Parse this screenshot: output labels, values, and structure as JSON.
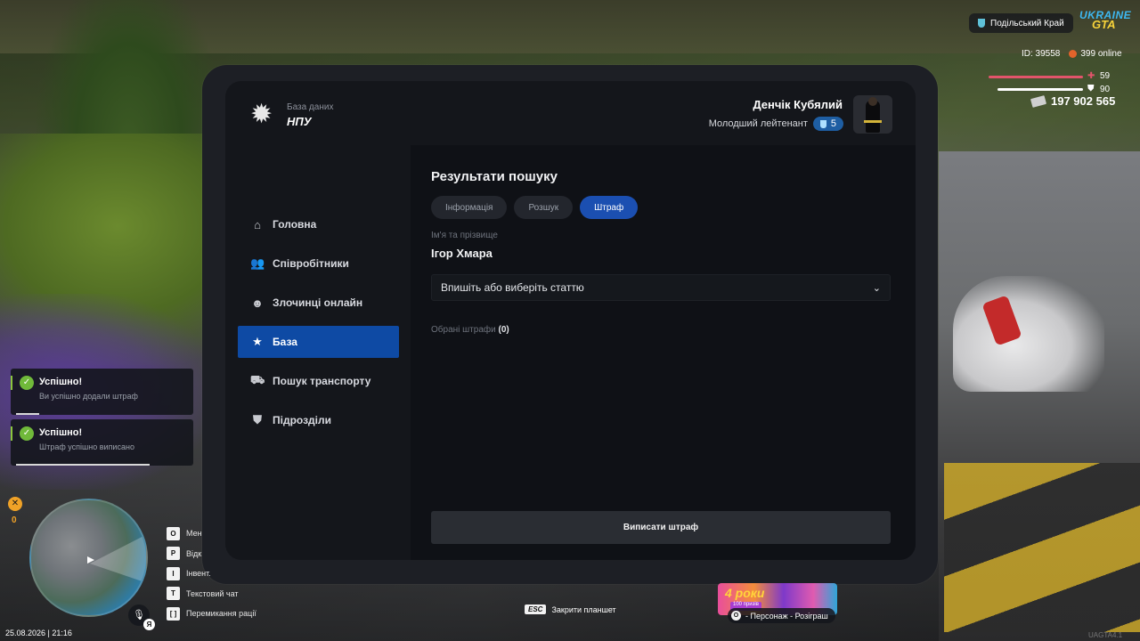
{
  "hud": {
    "region": "Подільський Край",
    "logo_line1": "UKRAINE",
    "logo_line2": "GTA",
    "id_text": "ID: 39558",
    "online_text": "399 online",
    "health": 59,
    "armor": 90,
    "money": "197 902 565"
  },
  "tablet": {
    "db_subtitle": "База даних",
    "db_title": "НПУ",
    "user_name": "Денчік Кубялий",
    "user_rank": "Молодший лейтенант",
    "rank_level": "5",
    "nav": [
      {
        "label": "Головна",
        "icon": "home-icon"
      },
      {
        "label": "Співробітники",
        "icon": "users-icon"
      },
      {
        "label": "Злочинці онлайн",
        "icon": "criminal-icon"
      },
      {
        "label": "База",
        "icon": "star-icon"
      },
      {
        "label": "Пошук транспорту",
        "icon": "car-icon"
      },
      {
        "label": "Підрозділи",
        "icon": "shield-star-icon"
      }
    ],
    "active_nav": "База",
    "title": "Результати пошуку",
    "tabs": [
      {
        "label": "Інформація"
      },
      {
        "label": "Розшук"
      },
      {
        "label": "Штраф"
      }
    ],
    "active_tab": "Штраф",
    "name_label": "Ім'я та прізвище",
    "name_value": "Ігор Хмара",
    "select_placeholder": "Впишіть або виберіть статтю",
    "selected_label": "Обрані штрафи",
    "selected_count": "(0)",
    "submit_label": "Виписати штраф"
  },
  "notifications": [
    {
      "title": "Успішно!",
      "text": "Ви успішно додали штраф"
    },
    {
      "title": "Успішно!",
      "text": "Штраф успішно виписано"
    }
  ],
  "bottom_hud": {
    "wrench_count": "0",
    "datetime": "25.08.2026 | 21:16",
    "mic_key": "Я",
    "keys": [
      {
        "key": "O",
        "label": "Мен"
      },
      {
        "key": "P",
        "label": "Відк"
      },
      {
        "key": "I",
        "label": "Інвент."
      },
      {
        "key": "T",
        "label": "Текстовий чат"
      },
      {
        "key": "[   ]",
        "label": "Перемикання рації"
      }
    ],
    "esc_key": "ESC",
    "esc_label": "Закрити планшет",
    "promo_title": "4 роки",
    "promo_sub": "100 призів",
    "promo_key": "O",
    "promo_label": "- Персонаж - Розіграш",
    "watermark": "UAGTA4.1"
  },
  "colors": {
    "accent": "#0e4aa4",
    "tab_active": "#1b4fb1",
    "success": "#70b93a",
    "health": "#e2546b"
  }
}
